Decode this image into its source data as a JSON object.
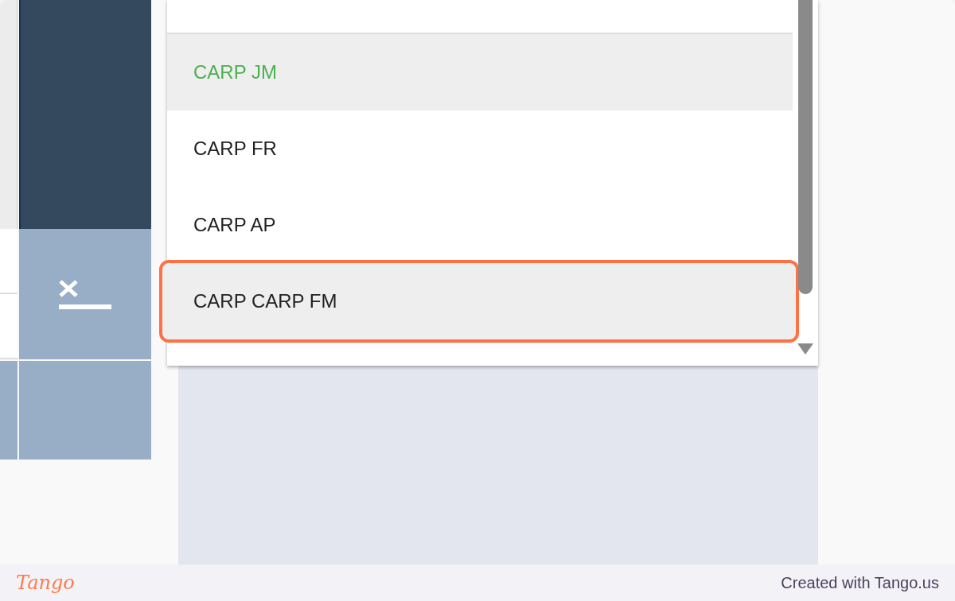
{
  "payclass_dropdown": {
    "items": [
      {
        "label": "CARP JM",
        "selected": true,
        "highlighted": false
      },
      {
        "label": "CARP FR",
        "selected": false,
        "highlighted": false
      },
      {
        "label": "CARP AP",
        "selected": false,
        "highlighted": false
      },
      {
        "label": "CARP CARP FM",
        "selected": false,
        "highlighted": true
      }
    ]
  },
  "footer": {
    "logo": "Tango",
    "credit": "Created with Tango.us"
  }
}
